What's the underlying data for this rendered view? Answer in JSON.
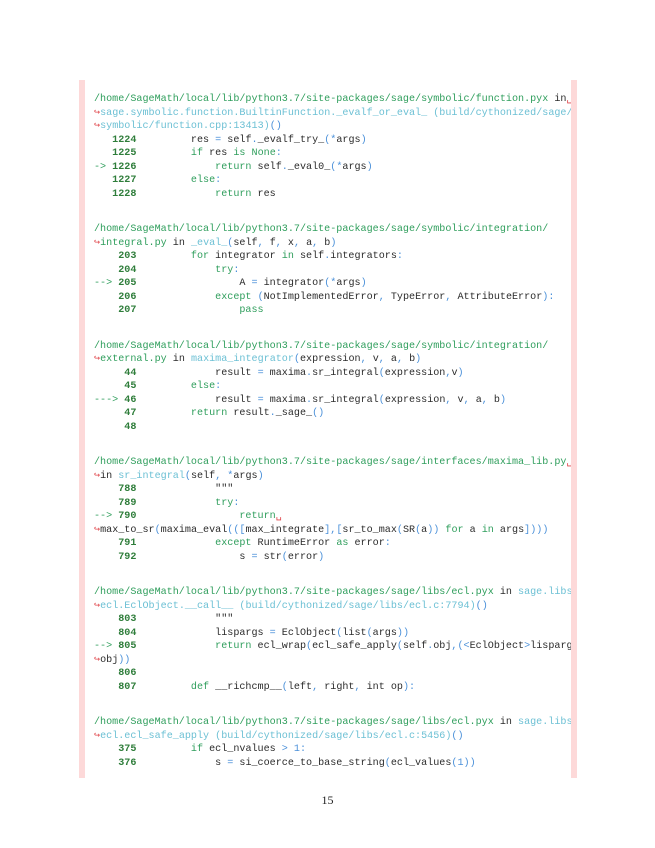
{
  "sections": [
    {
      "lines": [
        [
          [
            "g",
            "/home/SageMath/local/lib/python3.7/site-packages/sage/symbolic/function.pyx"
          ],
          [
            "t",
            " in"
          ],
          [
            "w",
            "␣"
          ]
        ],
        [
          [
            "w",
            "↪"
          ],
          [
            "c",
            "sage.symbolic.function.BuiltinFunction._evalf_or_eval_ (build/cythonized/sage/"
          ]
        ],
        [
          [
            "w",
            "↪"
          ],
          [
            "c",
            "symbolic/function.cpp:13413)"
          ],
          [
            "o",
            "()"
          ]
        ],
        [
          [
            "n",
            "   1224"
          ],
          [
            "t",
            "         res "
          ],
          [
            "o",
            "="
          ],
          [
            "t",
            " self"
          ],
          [
            "o",
            "."
          ],
          [
            "t",
            "_evalf_try_"
          ],
          [
            "o",
            "(*"
          ],
          [
            "t",
            "args"
          ],
          [
            "o",
            ")"
          ]
        ],
        [
          [
            "n",
            "   1225"
          ],
          [
            "g",
            "         if"
          ],
          [
            "t",
            " res "
          ],
          [
            "g",
            "is"
          ],
          [
            "g",
            " None"
          ],
          [
            "o",
            ":"
          ]
        ],
        [
          [
            "a",
            "-> "
          ],
          [
            "n",
            "1226"
          ],
          [
            "g",
            "             return"
          ],
          [
            "t",
            " self"
          ],
          [
            "o",
            "."
          ],
          [
            "t",
            "_eval0_"
          ],
          [
            "o",
            "(*"
          ],
          [
            "t",
            "args"
          ],
          [
            "o",
            ")"
          ]
        ],
        [
          [
            "n",
            "   1227"
          ],
          [
            "g",
            "         else"
          ],
          [
            "o",
            ":"
          ]
        ],
        [
          [
            "n",
            "   1228"
          ],
          [
            "g",
            "             return"
          ],
          [
            "t",
            " res"
          ]
        ]
      ]
    },
    {
      "lines": [
        [
          [
            "g",
            "/home/SageMath/local/lib/python3.7/site-packages/sage/symbolic/integration/"
          ]
        ],
        [
          [
            "w",
            "↪"
          ],
          [
            "g",
            "integral.py"
          ],
          [
            "t",
            " in "
          ],
          [
            "c",
            "_eval_"
          ],
          [
            "o",
            "("
          ],
          [
            "t",
            "self"
          ],
          [
            "o",
            ", "
          ],
          [
            "t",
            "f"
          ],
          [
            "o",
            ", "
          ],
          [
            "t",
            "x"
          ],
          [
            "o",
            ", "
          ],
          [
            "t",
            "a"
          ],
          [
            "o",
            ", "
          ],
          [
            "t",
            "b"
          ],
          [
            "o",
            ")"
          ]
        ],
        [
          [
            "n",
            "    203"
          ],
          [
            "g",
            "         for"
          ],
          [
            "t",
            " integrator "
          ],
          [
            "g",
            "in"
          ],
          [
            "t",
            " self"
          ],
          [
            "o",
            "."
          ],
          [
            "t",
            "integrators"
          ],
          [
            "o",
            ":"
          ]
        ],
        [
          [
            "n",
            "    204"
          ],
          [
            "g",
            "             try"
          ],
          [
            "o",
            ":"
          ]
        ],
        [
          [
            "a",
            "--> "
          ],
          [
            "n",
            "205"
          ],
          [
            "t",
            "                 A "
          ],
          [
            "o",
            "="
          ],
          [
            "t",
            " integrator"
          ],
          [
            "o",
            "(*"
          ],
          [
            "t",
            "args"
          ],
          [
            "o",
            ")"
          ]
        ],
        [
          [
            "n",
            "    206"
          ],
          [
            "g",
            "             except"
          ],
          [
            "t",
            " "
          ],
          [
            "o",
            "("
          ],
          [
            "t",
            "NotImplementedError"
          ],
          [
            "o",
            ", "
          ],
          [
            "t",
            "TypeError"
          ],
          [
            "o",
            ", "
          ],
          [
            "t",
            "AttributeError"
          ],
          [
            "o",
            "):"
          ]
        ],
        [
          [
            "n",
            "    207"
          ],
          [
            "g",
            "                 pass"
          ]
        ]
      ]
    },
    {
      "lines": [
        [
          [
            "g",
            "/home/SageMath/local/lib/python3.7/site-packages/sage/symbolic/integration/"
          ]
        ],
        [
          [
            "w",
            "↪"
          ],
          [
            "g",
            "external.py"
          ],
          [
            "t",
            " in "
          ],
          [
            "c",
            "maxima_integrator"
          ],
          [
            "o",
            "("
          ],
          [
            "t",
            "expression"
          ],
          [
            "o",
            ", "
          ],
          [
            "t",
            "v"
          ],
          [
            "o",
            ", "
          ],
          [
            "t",
            "a"
          ],
          [
            "o",
            ", "
          ],
          [
            "t",
            "b"
          ],
          [
            "o",
            ")"
          ]
        ],
        [
          [
            "n",
            "     44"
          ],
          [
            "t",
            "             result "
          ],
          [
            "o",
            "="
          ],
          [
            "t",
            " maxima"
          ],
          [
            "o",
            "."
          ],
          [
            "t",
            "sr_integral"
          ],
          [
            "o",
            "("
          ],
          [
            "t",
            "expression"
          ],
          [
            "o",
            ","
          ],
          [
            "t",
            "v"
          ],
          [
            "o",
            ")"
          ]
        ],
        [
          [
            "n",
            "     45"
          ],
          [
            "g",
            "         else"
          ],
          [
            "o",
            ":"
          ]
        ],
        [
          [
            "a",
            "---> "
          ],
          [
            "n",
            "46"
          ],
          [
            "t",
            "             result "
          ],
          [
            "o",
            "="
          ],
          [
            "t",
            " maxima"
          ],
          [
            "o",
            "."
          ],
          [
            "t",
            "sr_integral"
          ],
          [
            "o",
            "("
          ],
          [
            "t",
            "expression"
          ],
          [
            "o",
            ", "
          ],
          [
            "t",
            "v"
          ],
          [
            "o",
            ", "
          ],
          [
            "t",
            "a"
          ],
          [
            "o",
            ", "
          ],
          [
            "t",
            "b"
          ],
          [
            "o",
            ")"
          ]
        ],
        [
          [
            "n",
            "     47"
          ],
          [
            "g",
            "         return"
          ],
          [
            "t",
            " result"
          ],
          [
            "o",
            "."
          ],
          [
            "t",
            "_sage_"
          ],
          [
            "o",
            "()"
          ]
        ],
        [
          [
            "n",
            "     48"
          ]
        ]
      ]
    },
    {
      "lines": [
        [
          [
            "g",
            "/home/SageMath/local/lib/python3.7/site-packages/sage/interfaces/maxima_lib.py"
          ],
          [
            "w",
            "␣"
          ]
        ],
        [
          [
            "w",
            "↪"
          ],
          [
            "t",
            "in "
          ],
          [
            "c",
            "sr_integral"
          ],
          [
            "o",
            "("
          ],
          [
            "t",
            "self"
          ],
          [
            "o",
            ", *"
          ],
          [
            "t",
            "args"
          ],
          [
            "o",
            ")"
          ]
        ],
        [
          [
            "n",
            "    788"
          ],
          [
            "t",
            "             \"\"\""
          ]
        ],
        [
          [
            "n",
            "    789"
          ],
          [
            "g",
            "             try"
          ],
          [
            "o",
            ":"
          ]
        ],
        [
          [
            "a",
            "--> "
          ],
          [
            "n",
            "790"
          ],
          [
            "g",
            "                 return"
          ],
          [
            "w",
            "␣"
          ]
        ],
        [
          [
            "w",
            "↪"
          ],
          [
            "t",
            "max_to_sr"
          ],
          [
            "o",
            "("
          ],
          [
            "t",
            "maxima_eval"
          ],
          [
            "o",
            "((["
          ],
          [
            "t",
            "max_integrate"
          ],
          [
            "o",
            "],["
          ],
          [
            "t",
            "sr_to_max"
          ],
          [
            "o",
            "("
          ],
          [
            "t",
            "SR"
          ],
          [
            "o",
            "("
          ],
          [
            "t",
            "a"
          ],
          [
            "o",
            "))"
          ],
          [
            "g",
            " for"
          ],
          [
            "t",
            " a "
          ],
          [
            "g",
            "in"
          ],
          [
            "t",
            " args"
          ],
          [
            "o",
            "])))"
          ]
        ],
        [
          [
            "n",
            "    791"
          ],
          [
            "g",
            "             except"
          ],
          [
            "t",
            " RuntimeError "
          ],
          [
            "g",
            "as"
          ],
          [
            "t",
            " error"
          ],
          [
            "o",
            ":"
          ]
        ],
        [
          [
            "n",
            "    792"
          ],
          [
            "t",
            "                 s "
          ],
          [
            "o",
            "="
          ],
          [
            "t",
            " str"
          ],
          [
            "o",
            "("
          ],
          [
            "t",
            "error"
          ],
          [
            "o",
            ")"
          ]
        ]
      ]
    },
    {
      "lines": [
        [
          [
            "g",
            "/home/SageMath/local/lib/python3.7/site-packages/sage/libs/ecl.pyx"
          ],
          [
            "t",
            " in "
          ],
          [
            "c",
            "sage.libs"
          ]
        ],
        [
          [
            "w",
            "↪"
          ],
          [
            "c",
            "ecl.EclObject.__call__ (build/cythonized/sage/libs/ecl.c:7794)"
          ],
          [
            "o",
            "()"
          ]
        ],
        [
          [
            "n",
            "    803"
          ],
          [
            "t",
            "             \"\"\""
          ]
        ],
        [
          [
            "n",
            "    804"
          ],
          [
            "t",
            "             lispargs "
          ],
          [
            "o",
            "="
          ],
          [
            "t",
            " EclObject"
          ],
          [
            "o",
            "("
          ],
          [
            "t",
            "list"
          ],
          [
            "o",
            "("
          ],
          [
            "t",
            "args"
          ],
          [
            "o",
            "))"
          ]
        ],
        [
          [
            "a",
            "--> "
          ],
          [
            "n",
            "805"
          ],
          [
            "g",
            "             return"
          ],
          [
            "t",
            " ecl_wrap"
          ],
          [
            "o",
            "("
          ],
          [
            "t",
            "ecl_safe_apply"
          ],
          [
            "o",
            "("
          ],
          [
            "t",
            "self"
          ],
          [
            "o",
            "."
          ],
          [
            "t",
            "obj"
          ],
          [
            "o",
            ",(<"
          ],
          [
            "t",
            "EclObject"
          ],
          [
            "o",
            ">"
          ],
          [
            "t",
            "lispargs"
          ],
          [
            "o",
            ")."
          ]
        ],
        [
          [
            "w",
            "↪"
          ],
          [
            "t",
            "obj"
          ],
          [
            "o",
            "))"
          ]
        ],
        [
          [
            "n",
            "    806"
          ]
        ],
        [
          [
            "n",
            "    807"
          ],
          [
            "g",
            "         def"
          ],
          [
            "t",
            " __richcmp__"
          ],
          [
            "o",
            "("
          ],
          [
            "t",
            "left"
          ],
          [
            "o",
            ", "
          ],
          [
            "t",
            "right"
          ],
          [
            "o",
            ", "
          ],
          [
            "t",
            "int op"
          ],
          [
            "o",
            "):"
          ]
        ]
      ]
    },
    {
      "lines": [
        [
          [
            "g",
            "/home/SageMath/local/lib/python3.7/site-packages/sage/libs/ecl.pyx"
          ],
          [
            "t",
            " in "
          ],
          [
            "c",
            "sage.libs"
          ]
        ],
        [
          [
            "w",
            "↪"
          ],
          [
            "c",
            "ecl.ecl_safe_apply (build/cythonized/sage/libs/ecl.c:5456)"
          ],
          [
            "o",
            "()"
          ]
        ],
        [
          [
            "n",
            "    375"
          ],
          [
            "g",
            "         if"
          ],
          [
            "t",
            " ecl_nvalues "
          ],
          [
            "o",
            ">"
          ],
          [
            "o",
            " 1"
          ],
          [
            "o",
            ":"
          ]
        ],
        [
          [
            "n",
            "    376"
          ],
          [
            "t",
            "             s "
          ],
          [
            "o",
            "="
          ],
          [
            "t",
            " si_coerce_to_base_string"
          ],
          [
            "o",
            "("
          ],
          [
            "t",
            "ecl_values"
          ],
          [
            "o",
            "("
          ],
          [
            "o",
            "1"
          ],
          [
            "o",
            "))"
          ]
        ]
      ]
    }
  ],
  "page_number": "15"
}
